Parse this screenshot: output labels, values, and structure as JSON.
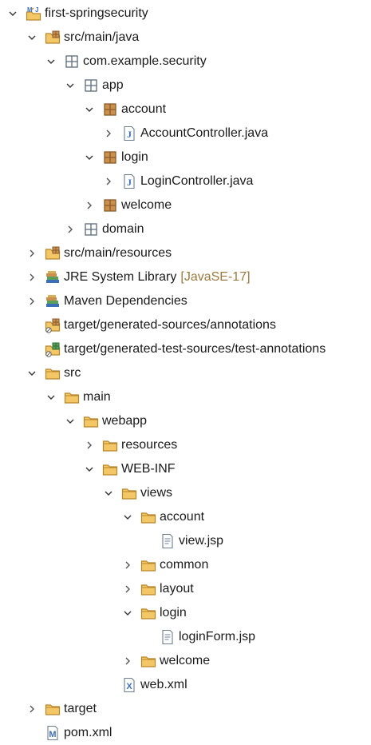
{
  "tree": [
    {
      "label": "first-springsecurity",
      "icon": "maven-project-icon",
      "expanded": true
    },
    {
      "label": "src/main/java",
      "icon": "source-folder-icon",
      "expanded": true
    },
    {
      "label": "com.example.security",
      "icon": "package-icon",
      "expanded": true
    },
    {
      "label": "app",
      "icon": "package-icon",
      "expanded": true
    },
    {
      "label": "account",
      "icon": "package-filled-icon",
      "expanded": true
    },
    {
      "label": "AccountController.java",
      "icon": "java-file-icon",
      "expanded": false
    },
    {
      "label": "login",
      "icon": "package-filled-icon",
      "expanded": true
    },
    {
      "label": "LoginController.java",
      "icon": "java-file-icon",
      "expanded": false
    },
    {
      "label": "welcome",
      "icon": "package-filled-icon",
      "expanded": false
    },
    {
      "label": "domain",
      "icon": "package-icon",
      "expanded": false
    },
    {
      "label": "src/main/resources",
      "icon": "source-folder-icon",
      "expanded": false
    },
    {
      "label": "JRE System Library",
      "decoration": "[JavaSE-17]",
      "icon": "library-icon",
      "expanded": false
    },
    {
      "label": "Maven Dependencies",
      "icon": "library-icon",
      "expanded": false
    },
    {
      "label": "target/generated-sources/annotations",
      "icon": "generated-source-folder-icon",
      "expanded": null
    },
    {
      "label": "target/generated-test-sources/test-annotations",
      "icon": "generated-test-source-folder-icon",
      "expanded": null
    },
    {
      "label": "src",
      "icon": "folder-icon",
      "expanded": true
    },
    {
      "label": "main",
      "icon": "folder-icon",
      "expanded": true
    },
    {
      "label": "webapp",
      "icon": "folder-icon",
      "expanded": true
    },
    {
      "label": "resources",
      "icon": "folder-icon",
      "expanded": false
    },
    {
      "label": "WEB-INF",
      "icon": "folder-icon",
      "expanded": true
    },
    {
      "label": "views",
      "icon": "folder-icon",
      "expanded": true
    },
    {
      "label": "account",
      "icon": "folder-icon",
      "expanded": true
    },
    {
      "label": "view.jsp",
      "icon": "jsp-file-icon",
      "expanded": null
    },
    {
      "label": "common",
      "icon": "folder-icon",
      "expanded": false
    },
    {
      "label": "layout",
      "icon": "folder-icon",
      "expanded": false
    },
    {
      "label": "login",
      "icon": "folder-icon",
      "expanded": true
    },
    {
      "label": "loginForm.jsp",
      "icon": "jsp-file-icon",
      "expanded": null
    },
    {
      "label": "welcome",
      "icon": "folder-icon",
      "expanded": false
    },
    {
      "label": "web.xml",
      "icon": "xml-file-icon",
      "expanded": null
    },
    {
      "label": "target",
      "icon": "folder-icon",
      "expanded": false
    },
    {
      "label": "pom.xml",
      "icon": "maven-pom-icon",
      "expanded": null
    }
  ],
  "colors": {
    "folder": "#e8b54a",
    "package_outline": "#5a6a7a",
    "package_filled": "#b07840",
    "java": "#3c6eb4",
    "decoration": "#9a7a40"
  }
}
